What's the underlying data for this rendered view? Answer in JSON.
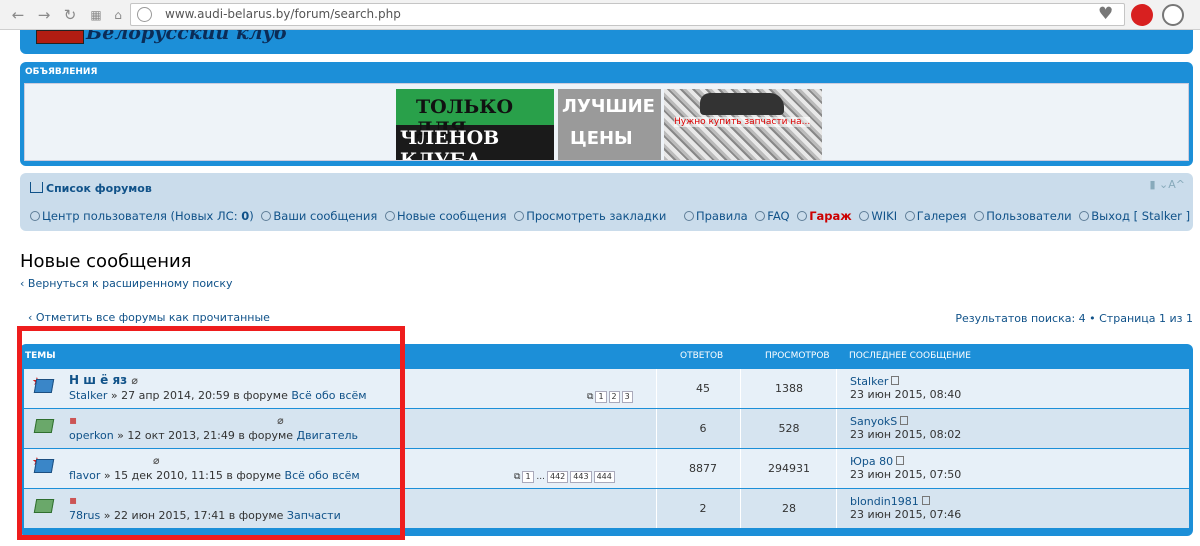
{
  "browser": {
    "url": "www.audi-belarus.by/forum/search.php"
  },
  "header": {
    "club_title": "Белорусский клуб"
  },
  "announcements": {
    "title": "ОБЪЯВЛЕНИЯ",
    "ad1_line1": "ТОЛЬКО ДЛЯ",
    "ad1_line2": "ЧЛЕНОВ КЛУБА",
    "ad2_line1": "ЛУЧШИЕ",
    "ad2_line2": "ЦЕНЫ",
    "ad3_text": "Нужно купить запчасти на..."
  },
  "nav": {
    "breadcrumb": "Список форумов",
    "font_tools": "A^",
    "user_center": "Центр пользователя (Новых ЛС: ",
    "new_pm_count": "0",
    "user_center_close": ")",
    "your_posts": "Ваши сообщения",
    "new_posts": "Новые сообщения",
    "bookmarks": "Просмотреть закладки",
    "rules": "Правила",
    "faq": "FAQ",
    "garage": "Гараж",
    "wiki": "WIKI",
    "gallery": "Галерея",
    "users": "Пользователи",
    "logout": "Выход [ Stalker ]"
  },
  "page": {
    "title": "Новые сообщения",
    "back_link": "‹ Вернуться к расширенному поиску",
    "mark_read": "‹ Отметить все форумы как прочитанные",
    "results": "Результатов поиска: 4 • Страница 1 из 1"
  },
  "table": {
    "headers": {
      "topics": "ТЕМЫ",
      "replies": "ОТВЕТОВ",
      "views": "ПРОСМОТРОВ",
      "last_post": "ПОСЛЕДНЕЕ СООБЩЕНИЕ"
    },
    "rows": [
      {
        "title": "Н ш          ё          яз",
        "author": "Stalker",
        "info": " » 27 апр 2014, 20:59 в форуме ",
        "forum": "Всё обо всём",
        "pages": [
          "1",
          "2",
          "3"
        ],
        "replies": "45",
        "views": "1388",
        "last_author": "Stalker",
        "last_date": "23 июн 2015, 08:40"
      },
      {
        "title": "",
        "author": "operkon",
        "info": " » 12 окт 2013, 21:49 в форуме ",
        "forum": "Двигатель",
        "replies": "6",
        "views": "528",
        "last_author": "SanyokS",
        "last_date": "23 июн 2015, 08:02"
      },
      {
        "title": "",
        "author": "flavor",
        "info": " » 15 дек 2010, 11:15 в форуме ",
        "forum": "Всё обо всём",
        "pages": [
          "1",
          "...",
          "442",
          "443",
          "444"
        ],
        "replies": "8877",
        "views": "294931",
        "last_author": "Юра 80",
        "last_date": "23 июн 2015, 07:50"
      },
      {
        "title": "",
        "author": "78rus",
        "info": " » 22 июн 2015, 17:41 в форуме ",
        "forum": "Запчасти",
        "replies": "2",
        "views": "28",
        "last_author": "blondin1981",
        "last_date": "23 июн 2015, 07:46"
      }
    ]
  }
}
